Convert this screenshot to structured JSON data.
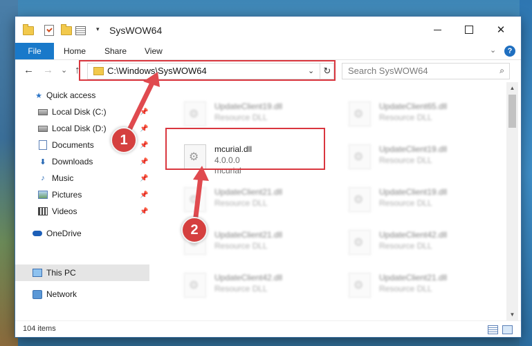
{
  "window": {
    "title": "SysWOW64",
    "qa_dropdown_glyph": "▾",
    "minimize_glyph": "",
    "close_glyph": "✕"
  },
  "ribbon": {
    "tabs": [
      "File",
      "Home",
      "Share",
      "View"
    ],
    "chevron_glyph": "⌄",
    "help_glyph": "?"
  },
  "nav": {
    "back_glyph": "←",
    "forward_glyph": "→",
    "recent_glyph": "⌄",
    "up_glyph": "↑",
    "address": "C:\\Windows\\SysWOW64",
    "address_dropdown_glyph": "⌄",
    "refresh_glyph": "↻",
    "search_placeholder": "Search SysWOW64",
    "search_glyph": "⌕"
  },
  "sidebar": {
    "items": [
      {
        "label": "Quick access",
        "icon": "star-icon",
        "pinned": false
      },
      {
        "label": "Local Disk (C:)",
        "icon": "disk-icon",
        "pinned": true
      },
      {
        "label": "Local Disk (D:)",
        "icon": "disk-icon",
        "pinned": true
      },
      {
        "label": "Documents",
        "icon": "documents-icon",
        "pinned": true
      },
      {
        "label": "Downloads",
        "icon": "downloads-icon",
        "pinned": true
      },
      {
        "label": "Music",
        "icon": "music-icon",
        "pinned": true
      },
      {
        "label": "Pictures",
        "icon": "pictures-icon",
        "pinned": true
      },
      {
        "label": "Videos",
        "icon": "videos-icon",
        "pinned": true
      },
      {
        "label": "OneDrive",
        "icon": "onedrive-icon",
        "pinned": false
      },
      {
        "label": "This PC",
        "icon": "this-pc-icon",
        "pinned": false,
        "selected": true
      },
      {
        "label": "Network",
        "icon": "network-icon",
        "pinned": false
      }
    ],
    "pin_glyph": "📌",
    "star_glyph": "★",
    "download_glyph": "⬇",
    "music_glyph": "♪"
  },
  "files": {
    "focused": {
      "name": "mcurial.dll",
      "version": "4.0.0.0",
      "description": "mcurial"
    },
    "background_tiles": [
      {
        "name": "UpdateClient19.dll",
        "type": "Resource DLL"
      },
      {
        "name": "UpdateClient65.dll",
        "type": "Resource DLL"
      },
      {
        "name": "UpdateClient19.dll",
        "type": "Resource DLL"
      },
      {
        "name": "UpdateClient21.dll",
        "type": "Resource DLL"
      },
      {
        "name": "UpdateClient19.dll",
        "type": "Resource DLL"
      },
      {
        "name": "UpdateClient21.dll",
        "type": "Resource DLL"
      },
      {
        "name": "UpdateClient42.dll",
        "type": "Resource DLL"
      },
      {
        "name": "UpdateClient42.dll",
        "type": "Resource DLL"
      },
      {
        "name": "UpdateClient21.dll",
        "type": "Resource DLL"
      }
    ]
  },
  "scrollbar": {
    "up_glyph": "▲",
    "down_glyph": "▼"
  },
  "status": {
    "item_count": "104 items"
  },
  "annotations": {
    "badge_1": "1",
    "badge_2": "2",
    "highlight_color": "#d9363e"
  }
}
